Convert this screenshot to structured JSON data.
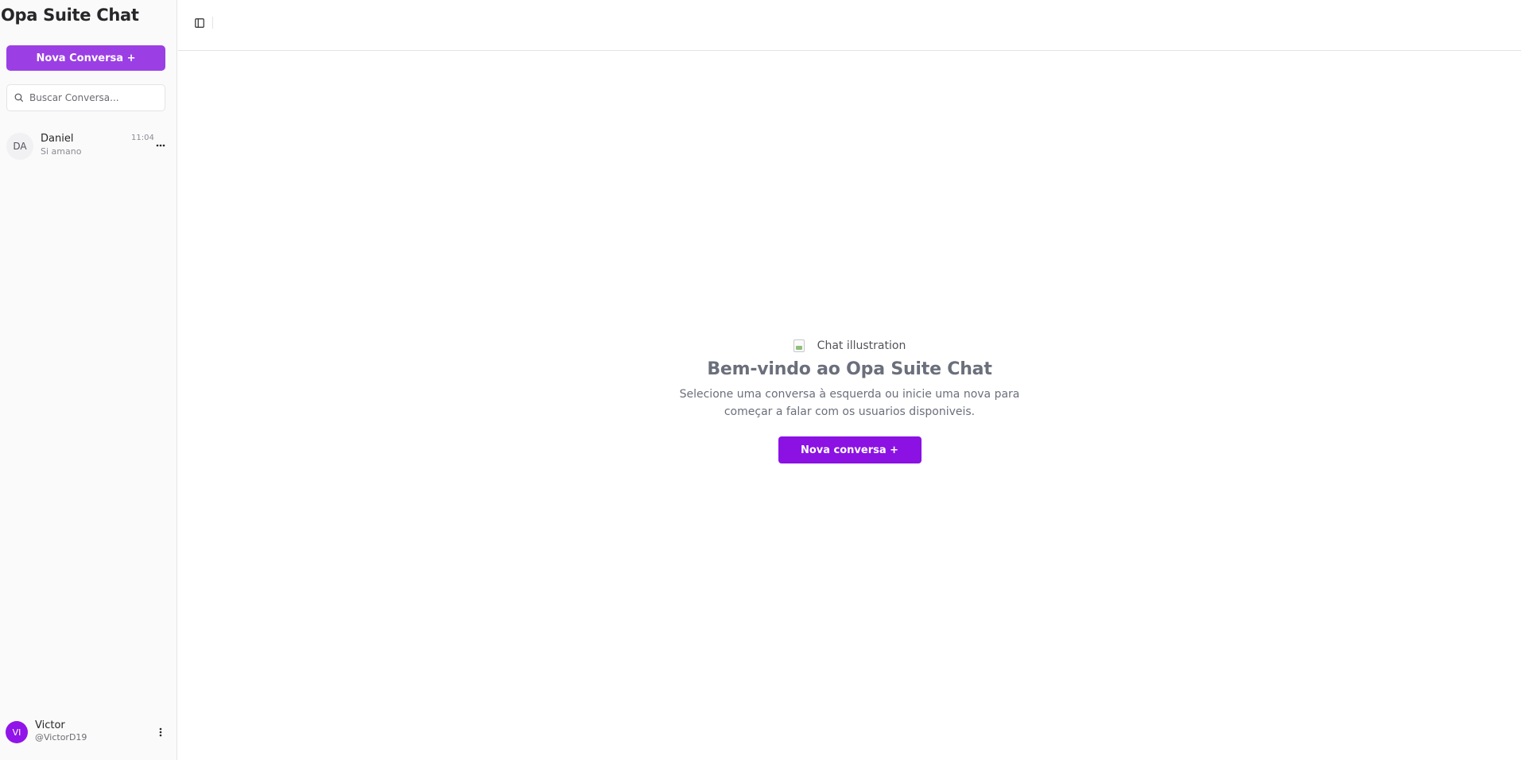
{
  "sidebar": {
    "app_title": "Opa Suite Chat",
    "new_chat_label": "Nova Conversa +",
    "search_placeholder": "Buscar Conversa...",
    "conversations": [
      {
        "initials": "DA",
        "name": "Daniel",
        "preview": "Si amano",
        "time": "11:04"
      }
    ],
    "user": {
      "initials": "VI",
      "name": "Victor",
      "handle": "@VictorD19"
    }
  },
  "main": {
    "illustration_alt": "Chat illustration",
    "welcome_title": "Bem-vindo ao Opa Suite Chat",
    "welcome_line1": "Selecione uma conversa à esquerda ou inicie uma nova para",
    "welcome_line2": "começar a falar com os usuarios disponiveis.",
    "new_chat_label": "Nova conversa +"
  },
  "colors": {
    "primary": "#9b3fe4",
    "primary_dark": "#8b12e3",
    "user_avatar": "#9115e8"
  },
  "icons": [
    "search-icon",
    "more-horizontal-icon",
    "more-vertical-icon",
    "sidebar-toggle-icon",
    "broken-image-icon"
  ]
}
